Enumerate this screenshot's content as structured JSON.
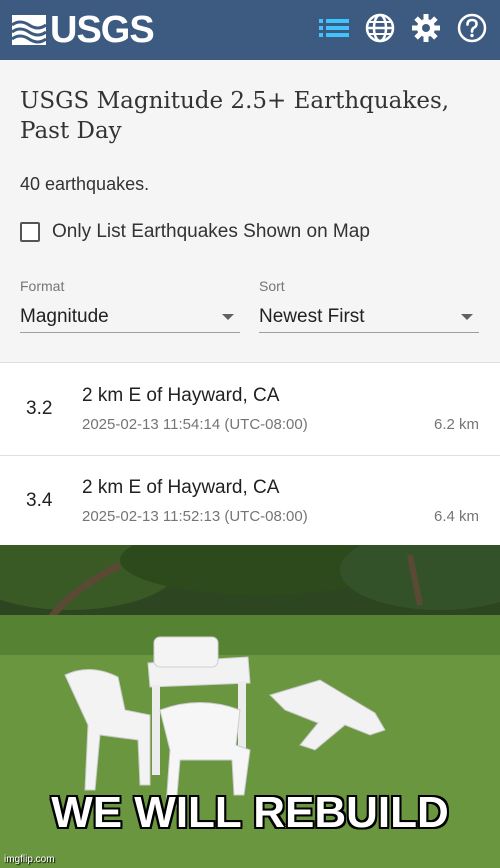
{
  "header": {
    "logo_text": "USGS",
    "brand_color": "#3d5a80",
    "icons": [
      "list-icon",
      "globe-icon",
      "gear-icon",
      "help-icon"
    ],
    "active_icon_color": "#40c4ff"
  },
  "panel": {
    "title": "USGS Magnitude 2.5+ Earthquakes, Past Day",
    "count_text": "40 earthquakes.",
    "checkbox_label": "Only List Earthquakes Shown on Map",
    "checkbox_checked": false,
    "format": {
      "label": "Format",
      "value": "Magnitude"
    },
    "sort": {
      "label": "Sort",
      "value": "Newest First"
    }
  },
  "earthquakes": [
    {
      "magnitude": "3.2",
      "place": "2 km E of Hayward, CA",
      "time": "2025-02-13 11:54:14 (UTC-08:00)",
      "depth": "6.2 km"
    },
    {
      "magnitude": "3.4",
      "place": "2 km E of Hayward, CA",
      "time": "2025-02-13 11:52:13 (UTC-08:00)",
      "depth": "6.4 km"
    }
  ],
  "meme": {
    "caption": "WE WILL REBUILD",
    "watermark": "imgflip.com"
  }
}
